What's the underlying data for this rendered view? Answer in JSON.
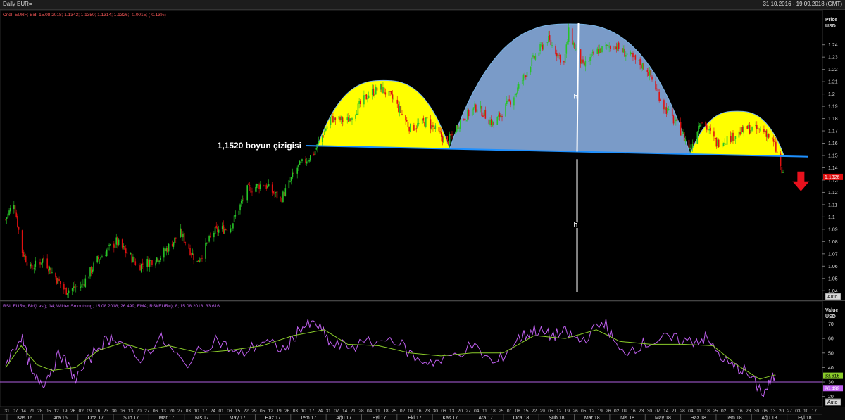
{
  "window": {
    "title": "Daily EUR=",
    "date_range": "31.10.2016 - 19.09.2018 (GMT)"
  },
  "price_panel": {
    "legend": "Cndl; EUR=; Bid; 15.08.2018; 1.1342; 1.1350; 1.1314; 1.1326; -0.0015; (-0.13%)",
    "axis_title": "Price\nUSD",
    "axis_title_1": "Price",
    "axis_title_2": "USD",
    "last_price_tag": "1.1326",
    "auto_label": "Auto",
    "neckline_label": "1,1520 boyun çizigisi",
    "h_label": "h",
    "h_label_2": "h",
    "colors": {
      "up": "#27c427",
      "down": "#e01010",
      "shoulders": "#ffff00",
      "head": "#7a9bc8",
      "neckline": "#1e90ff",
      "arrow": "#e8111d",
      "tag": "#e01010"
    }
  },
  "rsi_panel": {
    "legend": "RSI; EUR=; Bid(Last); 14; Wilder Smoothing; 15.08.2018; 26.499; EMA; RSI(EUR=); 8; 15.08.2018; 33.616",
    "axis_title_1": "Value",
    "axis_title_2": "USD",
    "rsi_tag": "26.499",
    "ema_tag": "33.616",
    "auto_label": "Auto",
    "colors": {
      "rsi": "#c060f0",
      "ema": "#8acb2a",
      "bands": "#b060e0"
    }
  },
  "chart_data": [
    {
      "type": "candlestick",
      "symbol": "EUR=",
      "ylim": [
        1.035,
        1.265
      ],
      "yticks": [
        1.04,
        1.05,
        1.06,
        1.07,
        1.08,
        1.09,
        1.1,
        1.11,
        1.12,
        1.13,
        1.14,
        1.15,
        1.16,
        1.17,
        1.18,
        1.19,
        1.2,
        1.21,
        1.22,
        1.23,
        1.24
      ],
      "ytick_labels": [
        "1.04",
        "1.05",
        "1.06",
        "1.07",
        "1.08",
        "1.09",
        "1.1",
        "1.11",
        "1.12",
        "1.13",
        "1.14",
        "1.15",
        "1.16",
        "1.17",
        "1.18",
        "1.19",
        "1.2",
        "1.21",
        "1.22",
        "1.23",
        "1.24"
      ],
      "neckline": 1.152,
      "last": 1.1326,
      "close_path": [
        {
          "date": "2016-10-31",
          "close": 1.098
        },
        {
          "date": "2016-11-07",
          "close": 1.112
        },
        {
          "date": "2016-11-14",
          "close": 1.072
        },
        {
          "date": "2016-11-21",
          "close": 1.058
        },
        {
          "date": "2016-12-02",
          "close": 1.066
        },
        {
          "date": "2016-12-09",
          "close": 1.055
        },
        {
          "date": "2016-12-20",
          "close": 1.04
        },
        {
          "date": "2017-01-03",
          "close": 1.044
        },
        {
          "date": "2017-01-16",
          "close": 1.065
        },
        {
          "date": "2017-02-01",
          "close": 1.08
        },
        {
          "date": "2017-02-20",
          "close": 1.06
        },
        {
          "date": "2017-03-10",
          "close": 1.068
        },
        {
          "date": "2017-03-27",
          "close": 1.087
        },
        {
          "date": "2017-04-10",
          "close": 1.063
        },
        {
          "date": "2017-04-24",
          "close": 1.088
        },
        {
          "date": "2017-05-08",
          "close": 1.092
        },
        {
          "date": "2017-05-22",
          "close": 1.122
        },
        {
          "date": "2017-06-05",
          "close": 1.127
        },
        {
          "date": "2017-06-19",
          "close": 1.114
        },
        {
          "date": "2017-07-03",
          "close": 1.14
        },
        {
          "date": "2017-07-17",
          "close": 1.152
        },
        {
          "date": "2017-07-31",
          "close": 1.18
        },
        {
          "date": "2017-08-14",
          "close": 1.178
        },
        {
          "date": "2017-09-01",
          "close": 1.2
        },
        {
          "date": "2017-09-11",
          "close": 1.205
        },
        {
          "date": "2017-09-22",
          "close": 1.195
        },
        {
          "date": "2017-10-06",
          "close": 1.172
        },
        {
          "date": "2017-10-20",
          "close": 1.178
        },
        {
          "date": "2017-11-06",
          "close": 1.16
        },
        {
          "date": "2017-11-17",
          "close": 1.178
        },
        {
          "date": "2017-12-01",
          "close": 1.19
        },
        {
          "date": "2017-12-15",
          "close": 1.175
        },
        {
          "date": "2018-01-03",
          "close": 1.202
        },
        {
          "date": "2018-01-15",
          "close": 1.225
        },
        {
          "date": "2018-01-29",
          "close": 1.245
        },
        {
          "date": "2018-02-12",
          "close": 1.225
        },
        {
          "date": "2018-02-16",
          "close": 1.25
        },
        {
          "date": "2018-02-28",
          "close": 1.222
        },
        {
          "date": "2018-03-12",
          "close": 1.235
        },
        {
          "date": "2018-03-26",
          "close": 1.24
        },
        {
          "date": "2018-04-09",
          "close": 1.23
        },
        {
          "date": "2018-04-23",
          "close": 1.22
        },
        {
          "date": "2018-05-07",
          "close": 1.19
        },
        {
          "date": "2018-05-21",
          "close": 1.17
        },
        {
          "date": "2018-05-29",
          "close": 1.155
        },
        {
          "date": "2018-06-07",
          "close": 1.18
        },
        {
          "date": "2018-06-20",
          "close": 1.16
        },
        {
          "date": "2018-07-03",
          "close": 1.165
        },
        {
          "date": "2018-07-16",
          "close": 1.172
        },
        {
          "date": "2018-07-31",
          "close": 1.17
        },
        {
          "date": "2018-08-08",
          "close": 1.158
        },
        {
          "date": "2018-08-15",
          "close": 1.1326
        }
      ]
    },
    {
      "type": "line",
      "title": "RSI",
      "ylim": [
        15,
        78
      ],
      "yticks": [
        20,
        30,
        40,
        50,
        60,
        70
      ],
      "ytick_labels": [
        "20",
        "30",
        "40",
        "50",
        "60",
        "70"
      ],
      "bands": [
        30,
        70
      ],
      "series": [
        {
          "name": "RSI",
          "points": [
            [
              0,
              42
            ],
            [
              0.02,
              62
            ],
            [
              0.035,
              33
            ],
            [
              0.05,
              30
            ],
            [
              0.07,
              50
            ],
            [
              0.09,
              32
            ],
            [
              0.12,
              55
            ],
            [
              0.14,
              62
            ],
            [
              0.17,
              45
            ],
            [
              0.2,
              60
            ],
            [
              0.23,
              42
            ],
            [
              0.27,
              60
            ],
            [
              0.3,
              48
            ],
            [
              0.33,
              58
            ],
            [
              0.36,
              52
            ],
            [
              0.38,
              68
            ],
            [
              0.4,
              70
            ],
            [
              0.42,
              55
            ],
            [
              0.45,
              55
            ],
            [
              0.5,
              60
            ],
            [
              0.53,
              45
            ],
            [
              0.56,
              44
            ],
            [
              0.6,
              55
            ],
            [
              0.63,
              42
            ],
            [
              0.66,
              60
            ],
            [
              0.68,
              66
            ],
            [
              0.7,
              62
            ],
            [
              0.72,
              64
            ],
            [
              0.74,
              58
            ],
            [
              0.77,
              72
            ],
            [
              0.79,
              50
            ],
            [
              0.82,
              56
            ],
            [
              0.85,
              60
            ],
            [
              0.88,
              58
            ],
            [
              0.9,
              60
            ],
            [
              0.93,
              42
            ],
            [
              0.95,
              38
            ],
            [
              0.975,
              22
            ],
            [
              0.99,
              35
            ]
          ]
        },
        {
          "name": "EMA",
          "points": [
            [
              0,
              40
            ],
            [
              0.02,
              55
            ],
            [
              0.04,
              42
            ],
            [
              0.06,
              38
            ],
            [
              0.09,
              40
            ],
            [
              0.12,
              52
            ],
            [
              0.15,
              57
            ],
            [
              0.18,
              52
            ],
            [
              0.21,
              55
            ],
            [
              0.25,
              50
            ],
            [
              0.29,
              52
            ],
            [
              0.33,
              55
            ],
            [
              0.37,
              62
            ],
            [
              0.41,
              66
            ],
            [
              0.44,
              56
            ],
            [
              0.48,
              55
            ],
            [
              0.52,
              50
            ],
            [
              0.56,
              48
            ],
            [
              0.6,
              50
            ],
            [
              0.64,
              50
            ],
            [
              0.68,
              62
            ],
            [
              0.72,
              60
            ],
            [
              0.76,
              66
            ],
            [
              0.79,
              58
            ],
            [
              0.83,
              56
            ],
            [
              0.87,
              56
            ],
            [
              0.91,
              55
            ],
            [
              0.94,
              42
            ],
            [
              0.97,
              32
            ],
            [
              0.99,
              35
            ]
          ]
        }
      ]
    }
  ],
  "xaxis": {
    "day_ticks": [
      "31",
      "07",
      "14",
      "21",
      "28",
      "05",
      "12",
      "19",
      "26",
      "02",
      "09",
      "16",
      "23",
      "30",
      "06",
      "13",
      "20",
      "27",
      "06",
      "13",
      "20",
      "27",
      "03",
      "10",
      "17",
      "24",
      "01",
      "08",
      "15",
      "22",
      "29",
      "05",
      "12",
      "19",
      "26",
      "03",
      "10",
      "17",
      "24",
      "31",
      "07",
      "14",
      "21",
      "28",
      "04",
      "11",
      "18",
      "25",
      "02",
      "09",
      "16",
      "23",
      "30",
      "06",
      "13",
      "20",
      "27",
      "04",
      "11",
      "18",
      "25",
      "01",
      "08",
      "15",
      "22",
      "29",
      "05",
      "12",
      "19",
      "26",
      "05",
      "12",
      "19",
      "26",
      "02",
      "09",
      "16",
      "23",
      "30",
      "07",
      "14",
      "21",
      "28",
      "04",
      "11",
      "18",
      "25",
      "02",
      "09",
      "16",
      "23",
      "30",
      "06",
      "13",
      "20",
      "27",
      "03",
      "10",
      "17"
    ],
    "months": [
      "Kas 16",
      "Ara 16",
      "Oca 17",
      "Şub 17",
      "Mar 17",
      "Nis 17",
      "May 17",
      "Haz 17",
      "Tem 17",
      "Ağu 17",
      "Eyl 17",
      "Eki 17",
      "Kas 17",
      "Ara 17",
      "Oca 18",
      "Şub 18",
      "Mar 18",
      "Nis 18",
      "May 18",
      "Haz 18",
      "Tem 18",
      "Ağu 18",
      "Eyl 18"
    ]
  }
}
